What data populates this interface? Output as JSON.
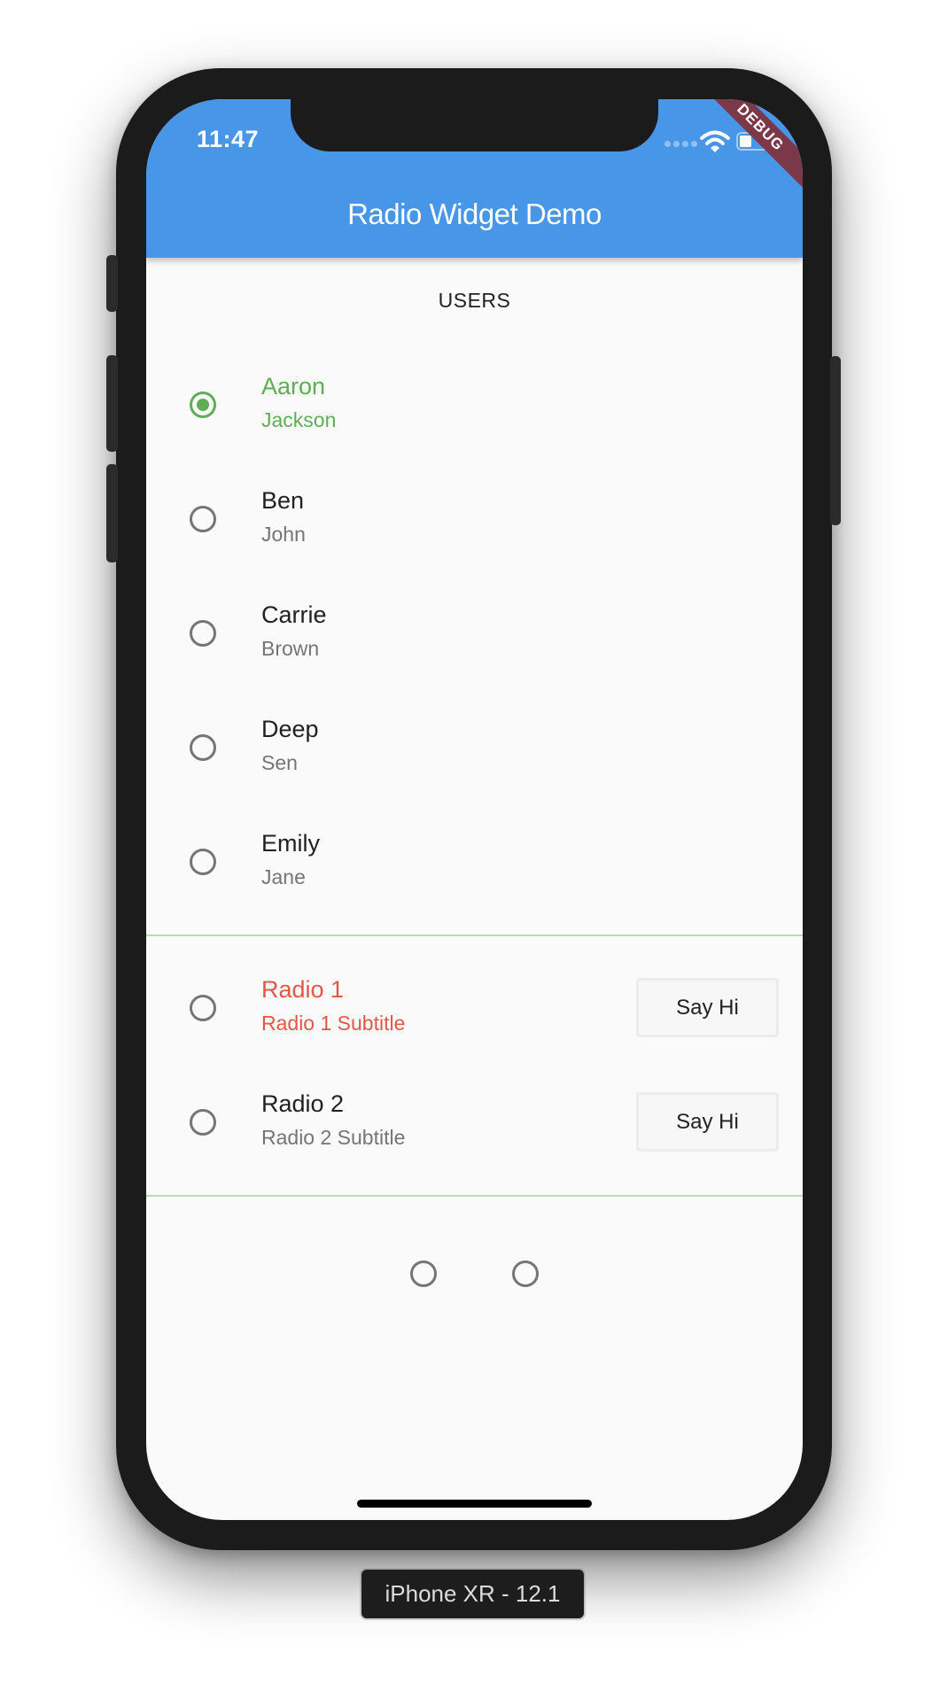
{
  "device": {
    "label": "iPhone XR - 12.1"
  },
  "status_bar": {
    "time": "11:47",
    "signal_icon": "cellular-signal-icon",
    "wifi_icon": "wifi-icon",
    "battery_icon": "battery-icon"
  },
  "debug_banner": "DEBUG",
  "app_bar": {
    "title": "Radio Widget Demo",
    "color": "#4796e8"
  },
  "users": {
    "heading": "USERS",
    "selected_index": 0,
    "items": [
      {
        "first": "Aaron",
        "last": "Jackson",
        "selected": true
      },
      {
        "first": "Ben",
        "last": "John",
        "selected": false
      },
      {
        "first": "Carrie",
        "last": "Brown",
        "selected": false
      },
      {
        "first": "Deep",
        "last": "Sen",
        "selected": false
      },
      {
        "first": "Emily",
        "last": "Jane",
        "selected": false
      }
    ]
  },
  "radio_tiles": [
    {
      "title": "Radio 1",
      "subtitle": "Radio 1 Subtitle",
      "button_label": "Say Hi",
      "highlighted": true,
      "selected": false
    },
    {
      "title": "Radio 2",
      "subtitle": "Radio 2 Subtitle",
      "button_label": "Say Hi",
      "highlighted": false,
      "selected": false
    }
  ],
  "bottom_radios": [
    {
      "selected": false
    },
    {
      "selected": false
    }
  ],
  "colors": {
    "selected_green": "#5fad56",
    "highlight_red": "#e65548",
    "divider": "#b9dcb5",
    "background": "#fafafa"
  }
}
